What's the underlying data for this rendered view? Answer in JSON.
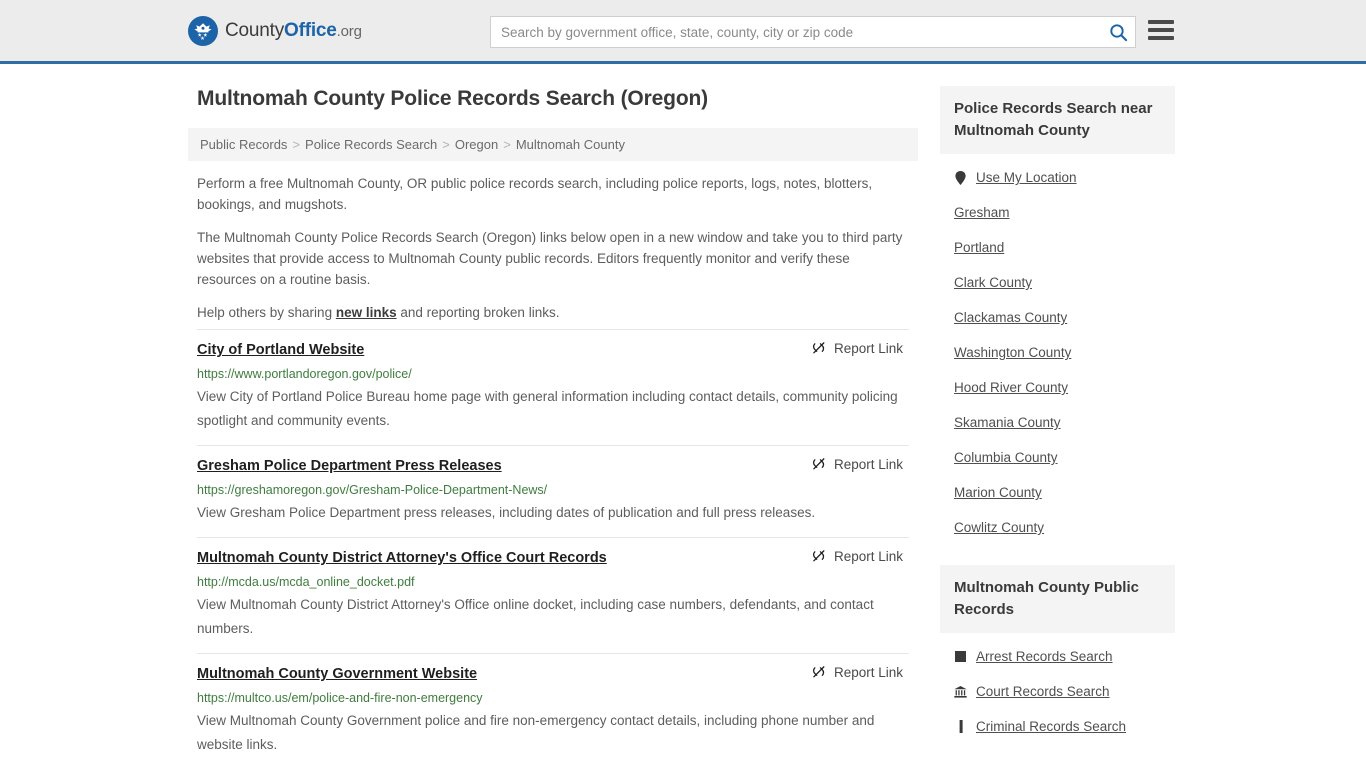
{
  "header": {
    "brand": {
      "county": "County",
      "office": "Office",
      "org": ".org"
    },
    "search": {
      "placeholder": "Search by government office, state, county, city or zip code",
      "value": ""
    },
    "menu_label": "Menu"
  },
  "page_title": "Multnomah County Police Records Search (Oregon)",
  "breadcrumb": {
    "items": [
      {
        "label": "Public Records"
      },
      {
        "label": "Police Records Search"
      },
      {
        "label": "Oregon"
      },
      {
        "label": "Multnomah County"
      }
    ],
    "separator": ">"
  },
  "intro": {
    "p1": "Perform a free Multnomah County, OR public police records search, including police reports, logs, notes, blotters, bookings, and mugshots.",
    "p2": "The Multnomah County Police Records Search (Oregon) links below open in a new window and take you to third party websites that provide access to Multnomah County public records. Editors frequently monitor and verify these resources on a routine basis.",
    "p3_before": "Help others by sharing ",
    "p3_link": "new links",
    "p3_after": " and reporting broken links."
  },
  "report_link_label": "Report Link",
  "results": [
    {
      "title": "City of Portland Website",
      "url": "https://www.portlandoregon.gov/police/",
      "description": "View City of Portland Police Bureau home page with general information including contact details, community policing spotlight and community events."
    },
    {
      "title": "Gresham Police Department Press Releases",
      "url": "https://greshamoregon.gov/Gresham-Police-Department-News/",
      "description": "View Gresham Police Department press releases, including dates of publication and full press releases."
    },
    {
      "title": "Multnomah County District Attorney's Office Court Records",
      "url": "http://mcda.us/mcda_online_docket.pdf",
      "description": "View Multnomah County District Attorney's Office online docket, including case numbers, defendants, and contact numbers."
    },
    {
      "title": "Multnomah County Government Website",
      "url": "https://multco.us/em/police-and-fire-non-emergency",
      "description": "View Multnomah County Government police and fire non-emergency contact details, including phone number and website links."
    }
  ],
  "sidebar": {
    "nearby": {
      "heading": "Police Records Search near Multnomah County",
      "items": [
        {
          "label": "Use My Location",
          "icon": "map-pin-icon"
        },
        {
          "label": "Gresham",
          "icon": ""
        },
        {
          "label": "Portland",
          "icon": ""
        },
        {
          "label": "Clark County",
          "icon": ""
        },
        {
          "label": "Clackamas County",
          "icon": ""
        },
        {
          "label": "Washington County",
          "icon": ""
        },
        {
          "label": "Hood River County",
          "icon": ""
        },
        {
          "label": "Skamania County",
          "icon": ""
        },
        {
          "label": "Columbia County",
          "icon": ""
        },
        {
          "label": "Marion County",
          "icon": ""
        },
        {
          "label": "Cowlitz County",
          "icon": ""
        }
      ]
    },
    "public_records": {
      "heading": "Multnomah County Public Records",
      "items": [
        {
          "label": "Arrest Records Search",
          "icon": "fingerprint-card-icon"
        },
        {
          "label": "Court Records Search",
          "icon": "courthouse-icon"
        },
        {
          "label": "Criminal Records Search",
          "icon": "document-icon"
        }
      ]
    }
  },
  "colors": {
    "header_bg": "#ececec",
    "header_border": "#2f6ea5",
    "brand_blue": "#1d63a8",
    "url_green": "#3f7d3f",
    "panel_bg": "#f4f4f4"
  }
}
